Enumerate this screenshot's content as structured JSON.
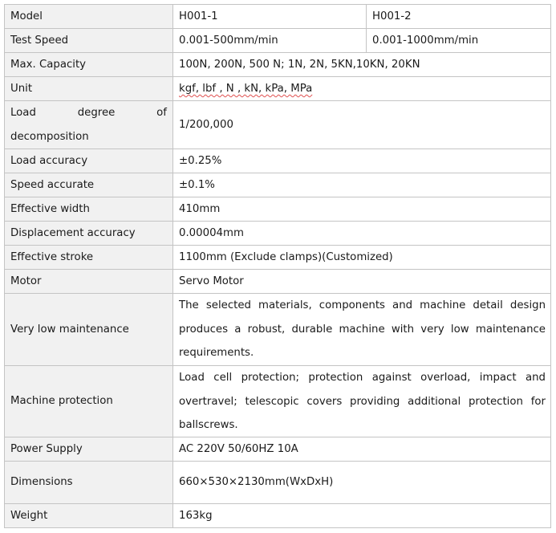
{
  "table": {
    "rows": [
      {
        "label": "Model",
        "value": "H001-1",
        "value2": "H001-2"
      },
      {
        "label": "Test Speed",
        "value": "0.001-500mm/min",
        "value2": "0.001-1000mm/min"
      },
      {
        "label": "Max. Capacity",
        "value": "100N, 200N, 500 N; 1N, 2N, 5KN,10KN, 20KN"
      },
      {
        "label": "Unit",
        "value": "kgf, lbf , N , kN, kPa, MPa"
      },
      {
        "label_words": [
          "Load",
          "degree",
          "of"
        ],
        "label_line2": "decomposition",
        "value": "1/200,000"
      },
      {
        "label": "Load accuracy",
        "value": "±0.25%"
      },
      {
        "label": "Speed accurate",
        "value": "±0.1%"
      },
      {
        "label": "Effective width",
        "value": "410mm"
      },
      {
        "label": "Displacement accuracy",
        "value": "0.00004mm"
      },
      {
        "label": "Effective stroke",
        "value": "1100mm (Exclude clamps)(Customized)"
      },
      {
        "label": "Motor",
        "value": "Servo Motor"
      },
      {
        "label": "Very low maintenance",
        "value": "The selected materials, components and machine detail design produces a robust, durable machine with very low maintenance requirements."
      },
      {
        "label": "Machine protection",
        "value": "Load cell protection; protection against overload, impact and overtravel; telescopic covers providing additional protection for ballscrews."
      },
      {
        "label": "Power Supply",
        "value": "AC 220V 50/60HZ 10A"
      },
      {
        "label": "Dimensions",
        "value": "660×530×2130mm(WxDxH)"
      },
      {
        "label": "Weight",
        "value": "163kg"
      }
    ]
  }
}
